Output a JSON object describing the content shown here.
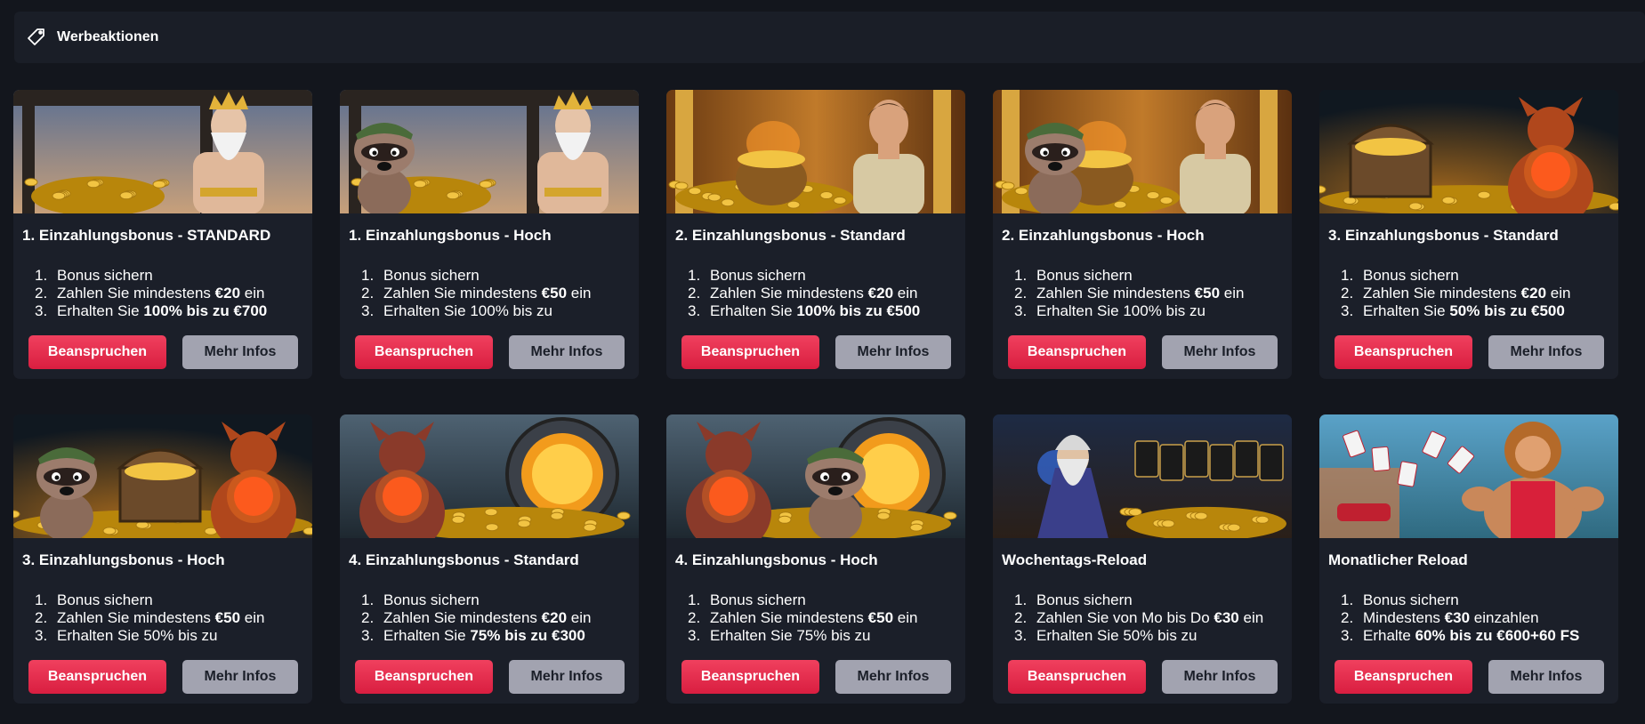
{
  "header": {
    "title": "Werbeaktionen",
    "icon": "tag-icon"
  },
  "buttons": {
    "claim": "Beanspruchen",
    "info": "Mehr Infos"
  },
  "colors": {
    "accent": "#e8294c",
    "card_bg": "#1b1f29",
    "page_bg": "#13161d",
    "info_btn": "#a2a3b0"
  },
  "cards": [
    {
      "title": "1. Einzahlungsbonus - STANDARD",
      "scene": "zeus",
      "steps": [
        {
          "n": "1.",
          "t": "Bonus sichern",
          "b": "",
          "a": ""
        },
        {
          "n": "2.",
          "t": "Zahlen Sie mindestens ",
          "b": "€20",
          "a": " ein"
        },
        {
          "n": "3.",
          "t": "Erhalten Sie ",
          "b": "100% bis zu €700",
          "a": ""
        }
      ]
    },
    {
      "title": "1. Einzahlungsbonus - Hoch",
      "scene": "zeus-raccoon",
      "steps": [
        {
          "n": "1.",
          "t": "Bonus sichern",
          "b": "",
          "a": ""
        },
        {
          "n": "2.",
          "t": "Zahlen Sie mindestens ",
          "b": "€50",
          "a": " ein"
        },
        {
          "n": "3.",
          "t": "Erhalten Sie 100% bis zu",
          "b": "",
          "a": ""
        }
      ]
    },
    {
      "title": "2. Einzahlungsbonus - Standard",
      "scene": "explorer",
      "steps": [
        {
          "n": "1.",
          "t": "Bonus sichern",
          "b": "",
          "a": ""
        },
        {
          "n": "2.",
          "t": "Zahlen Sie mindestens ",
          "b": "€20",
          "a": " ein"
        },
        {
          "n": "3.",
          "t": "Erhalten Sie ",
          "b": "100% bis zu €500",
          "a": ""
        }
      ]
    },
    {
      "title": "2. Einzahlungsbonus - Hoch",
      "scene": "explorer-raccoon",
      "steps": [
        {
          "n": "1.",
          "t": "Bonus sichern",
          "b": "",
          "a": ""
        },
        {
          "n": "2.",
          "t": "Zahlen Sie mindestens ",
          "b": "€50",
          "a": " ein"
        },
        {
          "n": "3.",
          "t": "Erhalten Sie 100% bis zu",
          "b": "",
          "a": ""
        }
      ]
    },
    {
      "title": "3. Einzahlungsbonus - Standard",
      "scene": "chest",
      "steps": [
        {
          "n": "1.",
          "t": "Bonus sichern",
          "b": "",
          "a": ""
        },
        {
          "n": "2.",
          "t": "Zahlen Sie mindestens ",
          "b": "€20",
          "a": " ein"
        },
        {
          "n": "3.",
          "t": "Erhalten Sie ",
          "b": "50% bis zu €500",
          "a": ""
        }
      ]
    },
    {
      "title": "3. Einzahlungsbonus - Hoch",
      "scene": "chest-raccoon",
      "steps": [
        {
          "n": "1.",
          "t": "Bonus sichern",
          "b": "",
          "a": ""
        },
        {
          "n": "2.",
          "t": "Zahlen Sie mindestens ",
          "b": "€50",
          "a": " ein"
        },
        {
          "n": "3.",
          "t": "Erhalten Sie 50% bis zu",
          "b": "",
          "a": ""
        }
      ]
    },
    {
      "title": "4. Einzahlungsbonus - Standard",
      "scene": "vault",
      "steps": [
        {
          "n": "1.",
          "t": "Bonus sichern",
          "b": "",
          "a": ""
        },
        {
          "n": "2.",
          "t": "Zahlen Sie mindestens ",
          "b": "€20",
          "a": " ein"
        },
        {
          "n": "3.",
          "t": "Erhalten Sie ",
          "b": "75% bis zu €300",
          "a": ""
        }
      ]
    },
    {
      "title": "4. Einzahlungsbonus - Hoch",
      "scene": "vault-raccoon",
      "steps": [
        {
          "n": "1.",
          "t": "Bonus sichern",
          "b": "",
          "a": ""
        },
        {
          "n": "2.",
          "t": "Zahlen Sie mindestens ",
          "b": "€50",
          "a": " ein"
        },
        {
          "n": "3.",
          "t": "Erhalten Sie 75% bis zu",
          "b": "",
          "a": ""
        }
      ]
    },
    {
      "title": "Wochentags-Reload",
      "scene": "wizard",
      "steps": [
        {
          "n": "1.",
          "t": "Bonus sichern",
          "b": "",
          "a": ""
        },
        {
          "n": "2.",
          "t": "Zahlen Sie von Mo bis Do ",
          "b": "€30",
          "a": " ein"
        },
        {
          "n": "3.",
          "t": "Erhalten Sie 50% bis zu",
          "b": "",
          "a": ""
        }
      ]
    },
    {
      "title": "Monatlicher Reload",
      "scene": "lion",
      "steps": [
        {
          "n": "1.",
          "t": "Bonus sichern",
          "b": "",
          "a": ""
        },
        {
          "n": "2.",
          "t": "Mindestens ",
          "b": "€30",
          "a": " einzahlen"
        },
        {
          "n": "3.",
          "t": "Erhalte ",
          "b": "60% bis zu €600+60 FS",
          "a": ""
        }
      ]
    }
  ]
}
